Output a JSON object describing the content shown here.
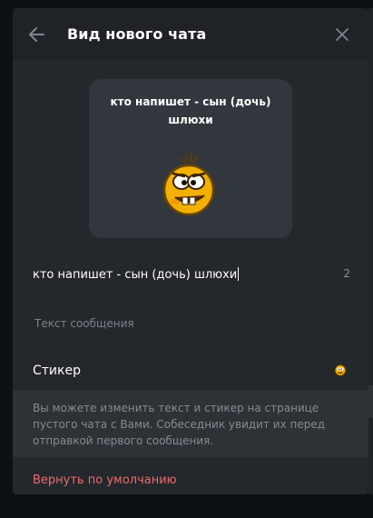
{
  "header": {
    "title": "Вид нового чата",
    "back_icon": "arrow-left-icon",
    "close_icon": "close-icon"
  },
  "preview": {
    "title": "кто напишет - сын (дочь) шлюхи",
    "sticker_icon": "smiley-sticker-icon"
  },
  "message_input": {
    "value": "кто напишет - сын (дочь) шлюхи",
    "counter": "2"
  },
  "text_field": {
    "placeholder": "Текст сообщения"
  },
  "sticker": {
    "label": "Стикер",
    "icon": "smiley-sticker-icon"
  },
  "info": {
    "text": "Вы можете изменить текст и стикер на странице пустого чата с Вами. Собеседник увидит их перед отправкой первого сообщения."
  },
  "actions": {
    "reset_label": "Вернуть по умолчанию"
  },
  "colors": {
    "background": "#1f2327",
    "card": "#32373d",
    "info_background": "#2d3237",
    "text": "#ffffff",
    "muted": "#858b91",
    "danger": "#ec6b6b"
  }
}
